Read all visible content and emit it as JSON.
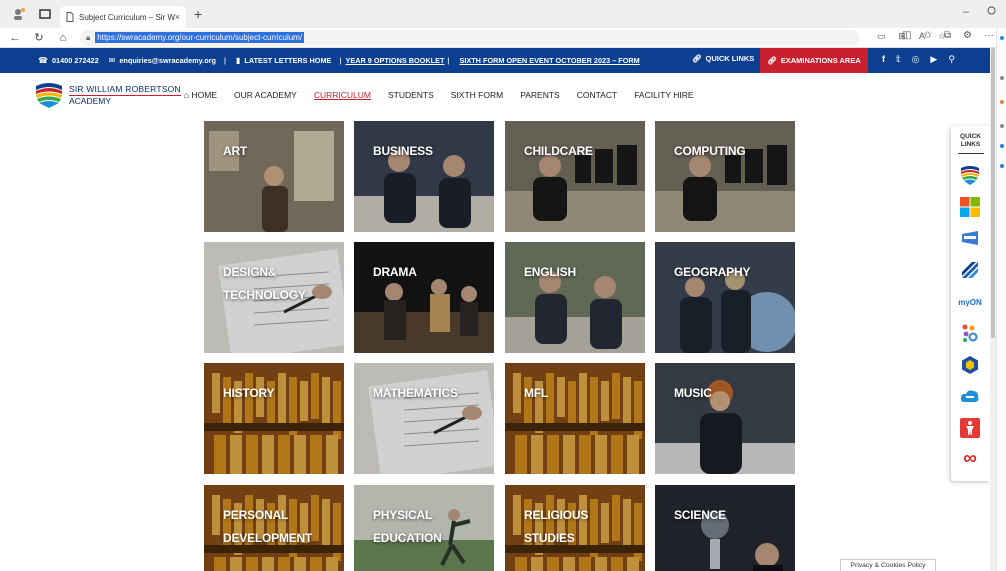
{
  "browser": {
    "tab_title": "Subject Curriculum – Sir William",
    "tab_close": "×",
    "new_tab": "+",
    "url": "https://swracademy.org/our-curriculum/subject-curriculum/",
    "minimize": "–",
    "maximize": "□"
  },
  "topstrip": {
    "phone": "01400 272422",
    "email": "enquiries@swracademy.org",
    "sep": "|",
    "latest_letters": "LATEST LETTERS HOME",
    "options_booklet": "YEAR 9 OPTIONS BOOKLET",
    "sixth_form_event": "SIXTH FORM OPEN EVENT OCTOBER 2023 – FORM",
    "quick_links": "QUICK LINKS",
    "exams": "EXAMINATIONS AREA"
  },
  "brand": {
    "line1": "SIR WILLIAM ROBERTSON",
    "line2": "ACADEMY"
  },
  "nav": {
    "items": [
      {
        "label": "HOME"
      },
      {
        "label": "OUR ACADEMY"
      },
      {
        "label": "CURRICULUM"
      },
      {
        "label": "STUDENTS"
      },
      {
        "label": "SIXTH FORM"
      },
      {
        "label": "PARENTS"
      },
      {
        "label": "CONTACT"
      },
      {
        "label": "FACILITY HIRE"
      }
    ],
    "active": "CURRICULUM"
  },
  "subjects": [
    {
      "line1": "ART",
      "line2": "",
      "scene": "art"
    },
    {
      "line1": "BUSINESS",
      "line2": "",
      "scene": "classroom"
    },
    {
      "line1": "CHILDCARE",
      "line2": "",
      "scene": "computers"
    },
    {
      "line1": "COMPUTING",
      "line2": "",
      "scene": "computers"
    },
    {
      "line1": "DESIGN&",
      "line2": "TECHNOLOGY",
      "scene": "paper"
    },
    {
      "line1": "DRAMA",
      "line2": "",
      "scene": "stage"
    },
    {
      "line1": "ENGLISH",
      "line2": "",
      "scene": "outdoor"
    },
    {
      "line1": "GEOGRAPHY",
      "line2": "",
      "scene": "globe"
    },
    {
      "line1": "HISTORY",
      "line2": "",
      "scene": "library"
    },
    {
      "line1": "MATHEMATICS",
      "line2": "",
      "scene": "paper"
    },
    {
      "line1": "MFL",
      "line2": "",
      "scene": "library"
    },
    {
      "line1": "MUSIC",
      "line2": "",
      "scene": "music"
    },
    {
      "line1": "PERSONAL",
      "line2": "DEVELOPMENT",
      "scene": "library"
    },
    {
      "line1": "PHYSICAL",
      "line2": "EDUCATION",
      "scene": "field"
    },
    {
      "line1": "RELIGIOUS",
      "line2": "STUDIES",
      "scene": "library"
    },
    {
      "line1": "SCIENCE",
      "line2": "",
      "scene": "lab"
    }
  ],
  "quick_panel": {
    "title_line1": "QUICK",
    "title_line2": "LINKS",
    "items": [
      "academy-logo-icon",
      "microsoft-icon",
      "smhw-icon",
      "arbor-icon",
      "myon-label",
      "dots-app-icon",
      "hexagon-app-icon",
      "cloud-chat-icon",
      "safeguarding-icon",
      "infinity-icon"
    ],
    "myon_text": "myON",
    "infinity_text": "∞"
  },
  "privacy": "Privacy & Cookies Policy",
  "colors": {
    "navy": "#0c3f8f",
    "red": "#c8202f",
    "brand_text": "#0c2d6b"
  }
}
